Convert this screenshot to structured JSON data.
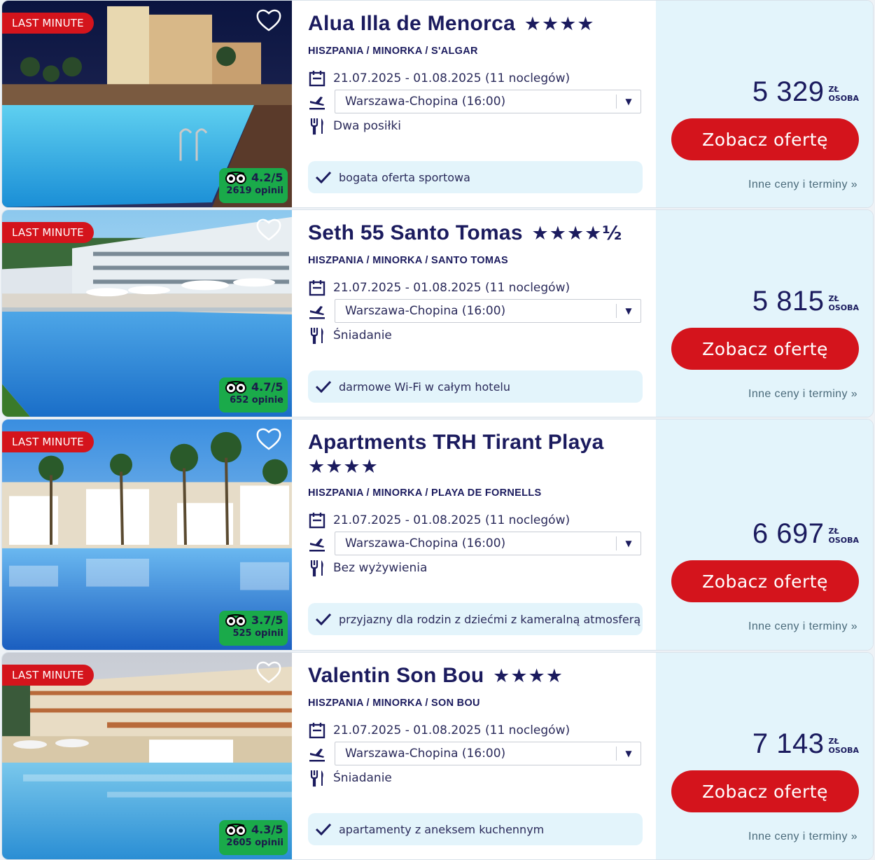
{
  "colors": {
    "brand_red": "#d4141c",
    "navy": "#1b1b5e",
    "price_bg": "#e3f4fb",
    "rating_green": "#1aaa4a"
  },
  "offers": [
    {
      "badge": "LAST MINUTE",
      "title": "Alua Illa de Menorca",
      "stars": "★★★★",
      "location": "HISZPANIA / MINORKA / S'ALGAR",
      "dates": "21.07.2025 - 01.08.2025 (11 noclegów)",
      "departure": "Warszawa-Chopina (16:00)",
      "board": "Dwa posiłki",
      "feature": "bogata oferta sportowa",
      "rating": "4.2/5",
      "reviews": "2619 opinii",
      "price": "5 329",
      "currency": "ZŁ",
      "per": "OSOBA",
      "cta": "Zobacz ofertę",
      "more": "Inne ceny i terminy »",
      "icons": [
        "heart-icon",
        "calendar-icon",
        "plane-icon",
        "cutlery-icon",
        "check-icon",
        "tripadvisor-icon"
      ]
    },
    {
      "badge": "LAST MINUTE",
      "title": "Seth 55 Santo Tomas",
      "stars": "★★★★½",
      "location": "HISZPANIA / MINORKA / SANTO TOMAS",
      "dates": "21.07.2025 - 01.08.2025 (11 noclegów)",
      "departure": "Warszawa-Chopina (16:00)",
      "board": "Śniadanie",
      "feature": "darmowe Wi-Fi w całym hotelu",
      "rating": "4.7/5",
      "reviews": "652 opinie",
      "price": "5 815",
      "currency": "ZŁ",
      "per": "OSOBA",
      "cta": "Zobacz ofertę",
      "more": "Inne ceny i terminy »"
    },
    {
      "badge": "LAST MINUTE",
      "title": "Apartments TRH Tirant Playa",
      "stars": "★★★★",
      "location": "HISZPANIA / MINORKA / PLAYA DE FORNELLS",
      "dates": "21.07.2025 - 01.08.2025 (11 noclegów)",
      "departure": "Warszawa-Chopina (16:00)",
      "board": "Bez wyżywienia",
      "feature": "przyjazny dla rodzin z dziećmi z kameralną atmosferą",
      "rating": "3.7/5",
      "reviews": "525 opinii",
      "price": "6 697",
      "currency": "ZŁ",
      "per": "OSOBA",
      "cta": "Zobacz ofertę",
      "more": "Inne ceny i terminy »"
    },
    {
      "badge": "LAST MINUTE",
      "title": "Valentin Son Bou",
      "stars": "★★★★",
      "location": "HISZPANIA / MINORKA / SON BOU",
      "dates": "21.07.2025 - 01.08.2025 (11 noclegów)",
      "departure": "Warszawa-Chopina (16:00)",
      "board": "Śniadanie",
      "feature": "apartamenty z aneksem kuchennym",
      "rating": "4.3/5",
      "reviews": "2605 opinii",
      "price": "7 143",
      "currency": "ZŁ",
      "per": "OSOBA",
      "cta": "Zobacz ofertę",
      "more": "Inne ceny i terminy »"
    }
  ]
}
